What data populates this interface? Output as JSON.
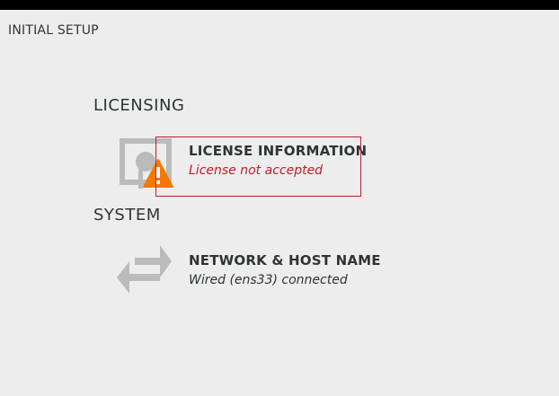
{
  "app": {
    "title": "INITIAL SETUP"
  },
  "sections": {
    "licensing": {
      "heading": "LICENSING",
      "spoke": {
        "title": "LICENSE INFORMATION",
        "status": "License not accepted",
        "icon": "license-certificate-icon",
        "badge_icon": "warning-icon",
        "status_color": "#c01c28"
      }
    },
    "system": {
      "heading": "SYSTEM",
      "spoke": {
        "title": "NETWORK & HOST NAME",
        "status": "Wired (ens33) connected",
        "icon": "network-transmit-receive-icon",
        "status_color": "#2e3436"
      }
    }
  },
  "colors": {
    "background": "#ededed",
    "topbar": "#000000",
    "warning": "#f57900",
    "error_border": "#c01c28",
    "icon_gray": "#bbbbbb"
  }
}
